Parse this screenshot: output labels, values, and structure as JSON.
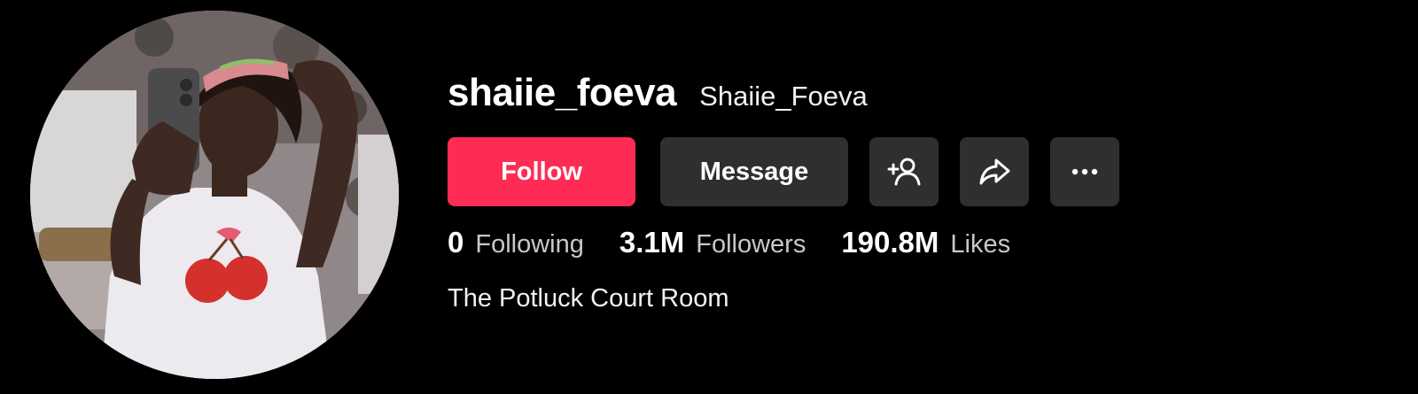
{
  "profile": {
    "username": "shaiie_foeva",
    "nickname": "Shaiie_Foeva",
    "avatar_icon": "profile-photo",
    "bio": "The Potluck Court Room"
  },
  "actions": {
    "follow_label": "Follow",
    "message_label": "Message",
    "add_friend_icon": "add-user-icon",
    "share_icon": "share-arrow-icon",
    "more_icon": "more-dots-icon"
  },
  "stats": {
    "following": {
      "count": "0",
      "label": "Following"
    },
    "followers": {
      "count": "3.1M",
      "label": "Followers"
    },
    "likes": {
      "count": "190.8M",
      "label": "Likes"
    }
  },
  "colors": {
    "background": "#000000",
    "follow_button": "#fe2c55",
    "secondary_button": "#2f2f2f",
    "text_primary": "#ffffff",
    "text_secondary": "#c8c8c8"
  }
}
